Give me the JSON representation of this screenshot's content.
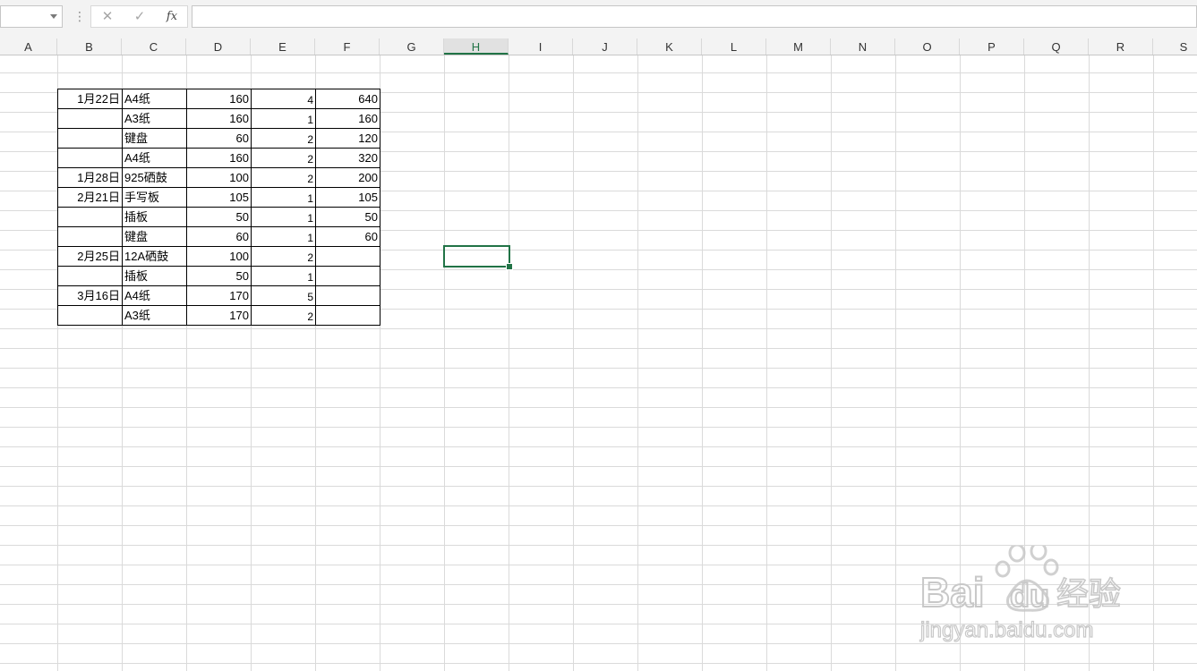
{
  "formula_bar": {
    "name_box_value": "",
    "formula_value": "",
    "cancel_icon": "✕",
    "enter_icon": "✓",
    "fx_label": "fx"
  },
  "columns": [
    "A",
    "B",
    "C",
    "D",
    "E",
    "F",
    "G",
    "H",
    "I",
    "J",
    "K",
    "L",
    "M",
    "N",
    "O",
    "P",
    "Q",
    "R",
    "S"
  ],
  "selected_column": "H",
  "table": {
    "rows": [
      {
        "date": "1月22日",
        "item": "A4纸",
        "price": "160",
        "qty": "4",
        "total": "640"
      },
      {
        "date": "",
        "item": "A3纸",
        "price": "160",
        "qty": "1",
        "total": "160"
      },
      {
        "date": "",
        "item": "键盘",
        "price": "60",
        "qty": "2",
        "total": "120"
      },
      {
        "date": "",
        "item": "A4纸",
        "price": "160",
        "qty": "2",
        "total": "320"
      },
      {
        "date": "1月28日",
        "item": "925硒鼓",
        "price": "100",
        "qty": "2",
        "total": "200"
      },
      {
        "date": "2月21日",
        "item": "手写板",
        "price": "105",
        "qty": "1",
        "total": "105"
      },
      {
        "date": "",
        "item": "插板",
        "price": "50",
        "qty": "1",
        "total": "50"
      },
      {
        "date": "",
        "item": "键盘",
        "price": "60",
        "qty": "1",
        "total": "60"
      },
      {
        "date": "2月25日",
        "item": "12A硒鼓",
        "price": "100",
        "qty": "2",
        "total": ""
      },
      {
        "date": "",
        "item": "插板",
        "price": "50",
        "qty": "1",
        "total": ""
      },
      {
        "date": "3月16日",
        "item": "A4纸",
        "price": "170",
        "qty": "5",
        "total": ""
      },
      {
        "date": "",
        "item": "A3纸",
        "price": "170",
        "qty": "2",
        "total": ""
      }
    ]
  },
  "watermark": {
    "brand": "Bai",
    "brand_du": "du",
    "brand_cn": "经验",
    "url": "jingyan.baidu.com"
  },
  "colors": {
    "accent": "#217346",
    "gridline": "#dadada",
    "header_bg": "#f3f3f3"
  }
}
